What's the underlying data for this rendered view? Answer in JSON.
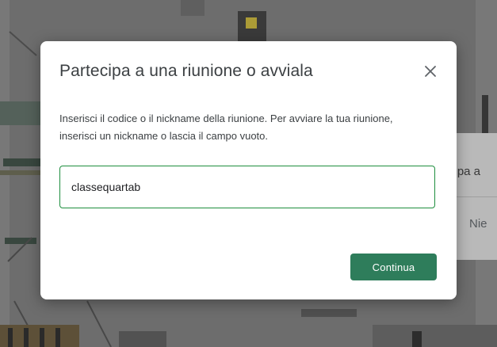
{
  "dialog": {
    "title": "Partecipa a una riunione o avviala",
    "description": "Inserisci il codice o il nickname della riunione. Per avviare la tua riunione, inserisci un nickname o lascia il campo vuoto.",
    "input_value": "classequartab",
    "continue_label": "Continua",
    "close_icon": "close-icon"
  },
  "background_card": {
    "partial_text_1": "cipa a",
    "partial_text_2": "Nie"
  },
  "colors": {
    "accent": "#1e8e3e",
    "button": "#2e7d5b",
    "title_text": "#3c4043"
  }
}
